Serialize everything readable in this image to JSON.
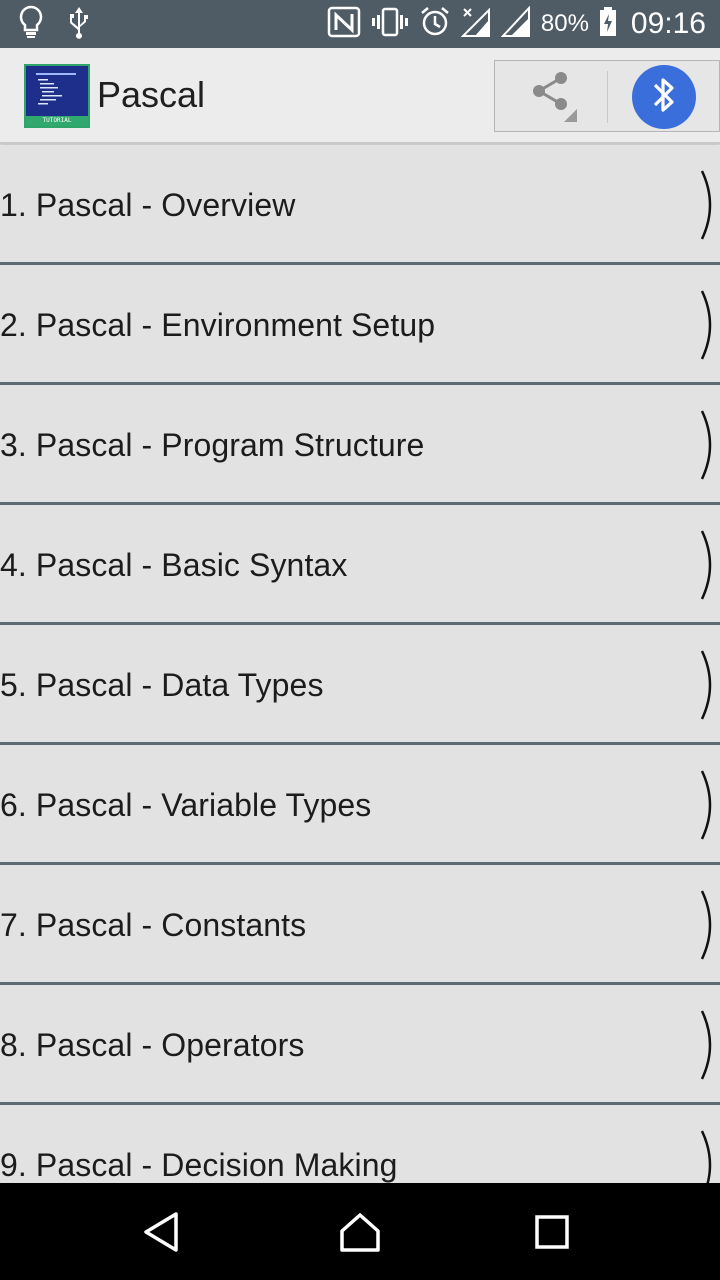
{
  "status_bar": {
    "icons_left": [
      "lightbulb-icon",
      "usb-icon"
    ],
    "icons_right": [
      "nfc-icon",
      "vibrate-icon",
      "alarm-icon",
      "signal-no-data-icon",
      "signal-icon",
      "battery-charging-icon"
    ],
    "battery": "80%",
    "time": "09:16"
  },
  "app_bar": {
    "title": "Pascal",
    "logo_icon": "pascal-tutorial-logo",
    "logo_text": "TUTORIAL",
    "share_icon": "share-icon",
    "bluetooth_icon": "bluetooth-icon",
    "accent": "#3a6edb"
  },
  "list": {
    "items": [
      {
        "label": "1. Pascal - Overview"
      },
      {
        "label": "2. Pascal - Environment Setup"
      },
      {
        "label": "3. Pascal - Program Structure"
      },
      {
        "label": "4. Pascal - Basic Syntax"
      },
      {
        "label": "5. Pascal - Data Types"
      },
      {
        "label": "6. Pascal - Variable Types"
      },
      {
        "label": "7. Pascal - Constants"
      },
      {
        "label": "8. Pascal - Operators"
      },
      {
        "label": "9. Pascal - Decision Making"
      }
    ]
  },
  "nav_bar": {
    "back_icon": "back-icon",
    "home_icon": "home-icon",
    "recents_icon": "recents-icon"
  }
}
